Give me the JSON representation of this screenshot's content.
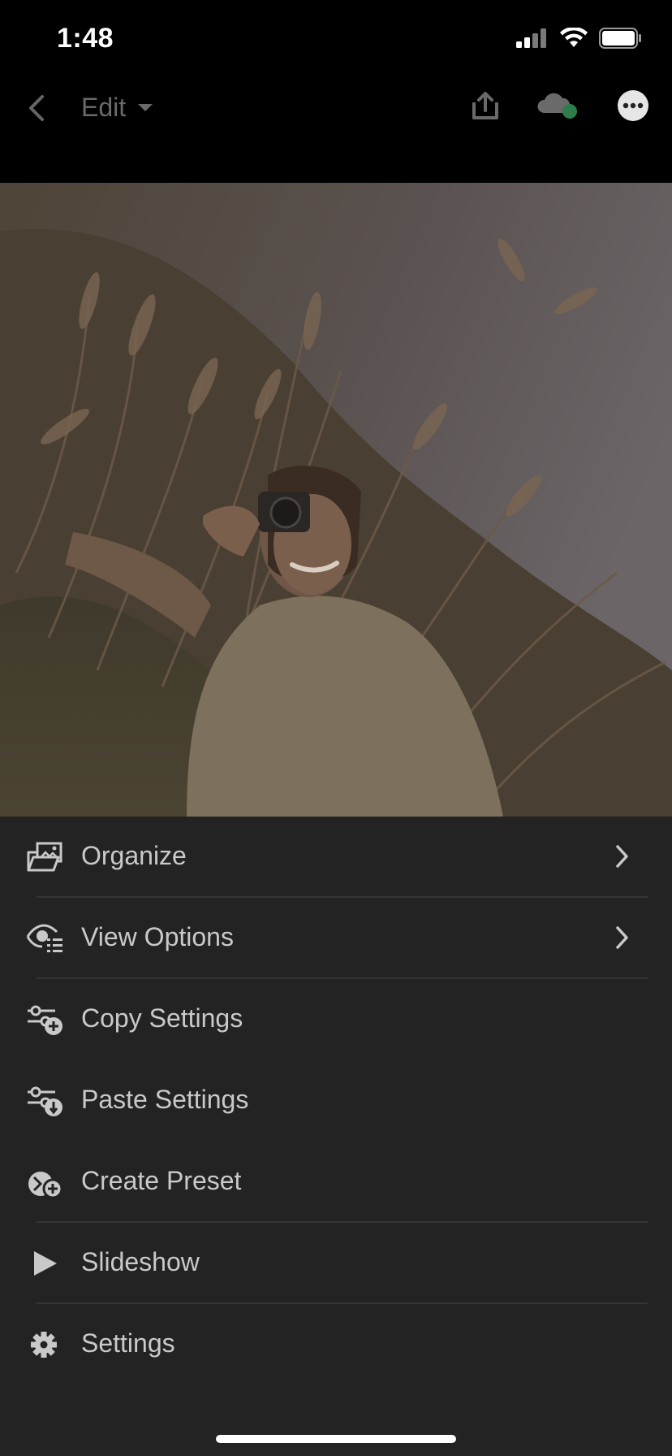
{
  "status_bar": {
    "time": "1:48"
  },
  "app_bar": {
    "title": "Edit"
  },
  "icons": {
    "back": "chevron-left-icon",
    "dropdown": "caret-down-icon",
    "share": "share-icon",
    "cloud": "cloud-sync-icon",
    "more": "more-icon"
  },
  "colors": {
    "sheet_bg": "#232323",
    "sync_dot": "#2e7d4a"
  },
  "menu": {
    "items": [
      {
        "label": "Organize",
        "icon": "folder-photo-icon",
        "has_chevron": true
      },
      {
        "label": "View Options",
        "icon": "eye-list-icon",
        "has_chevron": true
      },
      {
        "label": "Copy Settings",
        "icon": "sliders-plus-icon",
        "has_chevron": false
      },
      {
        "label": "Paste Settings",
        "icon": "sliders-download-icon",
        "has_chevron": false
      },
      {
        "label": "Create Preset",
        "icon": "preset-plus-icon",
        "has_chevron": false
      },
      {
        "label": "Slideshow",
        "icon": "play-icon",
        "has_chevron": false
      },
      {
        "label": "Settings",
        "icon": "gear-icon",
        "has_chevron": false
      }
    ]
  }
}
